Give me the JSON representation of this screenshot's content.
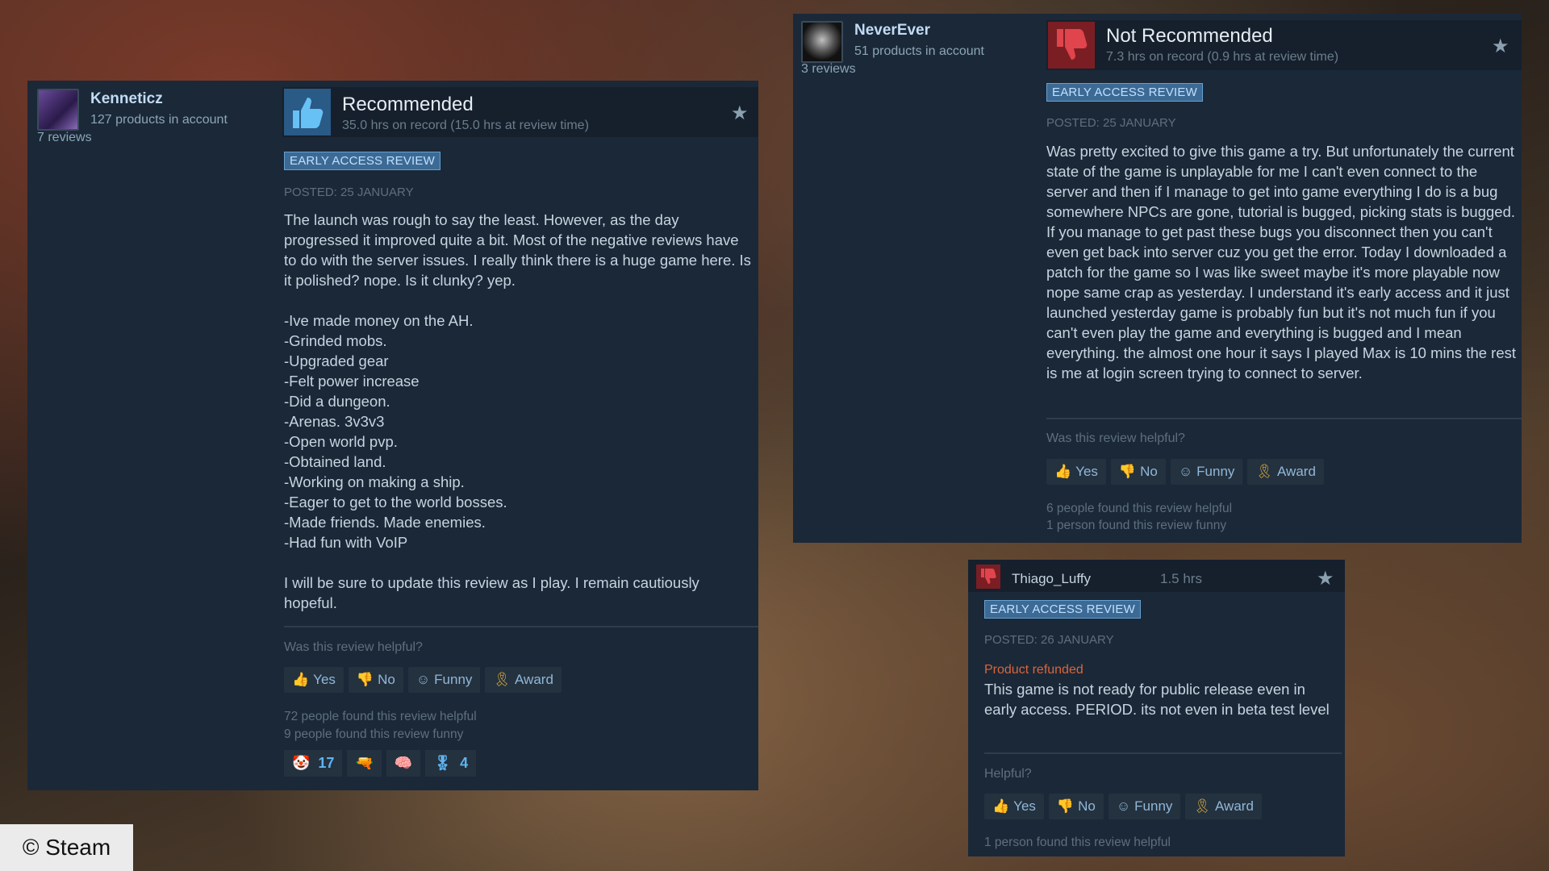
{
  "review1": {
    "username": "Kenneticz",
    "products": "127 products in account",
    "reviews": "7 reviews",
    "verdict": "Recommended",
    "hours": "35.0 hrs on record (15.0 hrs at review time)",
    "badge": "EARLY ACCESS REVIEW",
    "posted": "POSTED: 25 JANUARY",
    "body": "The launch was rough to say the least. However, as the day progressed it improved quite a bit. Most of the negative reviews have to do with the server issues. I really think there is a huge game here. Is it polished? nope. Is it clunky? yep.\n\n-Ive made money on the AH.\n-Grinded mobs.\n-Upgraded gear\n-Felt power increase\n-Did a dungeon.\n-Arenas. 3v3v3\n-Open world pvp.\n-Obtained land.\n-Working on making a ship.\n-Eager to get to the world bosses.\n-Made friends. Made enemies.\n-Had fun with VoIP\n\nI will be sure to update this review as I play. I remain cautiously hopeful.",
    "helpful_q": "Was this review helpful?",
    "buttons": {
      "yes": "Yes",
      "no": "No",
      "funny": "Funny",
      "award": "Award"
    },
    "helpful_count": "72 people found this review helpful",
    "funny_count": "9 people found this review funny",
    "awards": [
      {
        "icon": "clown-award-icon",
        "count": "17"
      },
      {
        "icon": "gun-award-icon",
        "count": ""
      },
      {
        "icon": "brain-award-icon",
        "count": ""
      },
      {
        "icon": "medal-award-icon",
        "count": "4"
      }
    ]
  },
  "review2": {
    "username": "NeverEver",
    "products": "51 products in account",
    "reviews": "3 reviews",
    "verdict": "Not Recommended",
    "hours": "7.3 hrs on record (0.9 hrs at review time)",
    "badge": "EARLY ACCESS REVIEW",
    "posted": "POSTED: 25 JANUARY",
    "body": "Was pretty excited to give this game a try. But unfortunately the current state of the game is unplayable for me I can't even connect to the server and then if I manage to get into game everything I do is a bug somewhere NPCs are gone, tutorial is bugged, picking stats is bugged. If you manage to get past these bugs you disconnect then you can't even get back into server cuz you get the error. Today I downloaded a patch for the game so I was like sweet maybe it's more playable now nope same crap as yesterday. I understand it's early access and it just launched yesterday game is probably fun but it's not much fun if you can't even play the game and everything is bugged and I mean everything. the almost one hour it says I played Max is 10 mins the rest is me at login screen trying to connect to server.",
    "helpful_q": "Was this review helpful?",
    "buttons": {
      "yes": "Yes",
      "no": "No",
      "funny": "Funny",
      "award": "Award"
    },
    "helpful_count": "6 people found this review helpful",
    "funny_count": "1 person found this review funny"
  },
  "review3": {
    "username": "Thiago_Luffy",
    "hours": "1.5 hrs",
    "badge": "EARLY ACCESS REVIEW",
    "posted": "POSTED: 26 JANUARY",
    "refunded": "Product refunded",
    "body": "This game is not ready for public release even in early access. PERIOD. its not even in beta test level",
    "helpful_q": "Helpful?",
    "buttons": {
      "yes": "Yes",
      "no": "No",
      "funny": "Funny",
      "award": "Award"
    },
    "helpful_count": "1 person found this review helpful"
  },
  "copyright": "© Steam",
  "colors": {
    "panel": "#1b2838",
    "header": "#16202d",
    "thumb_up": "#4ea6e8",
    "thumb_down": "#c4323a",
    "badge": "#3c6a94",
    "refunded": "#d8663a"
  }
}
